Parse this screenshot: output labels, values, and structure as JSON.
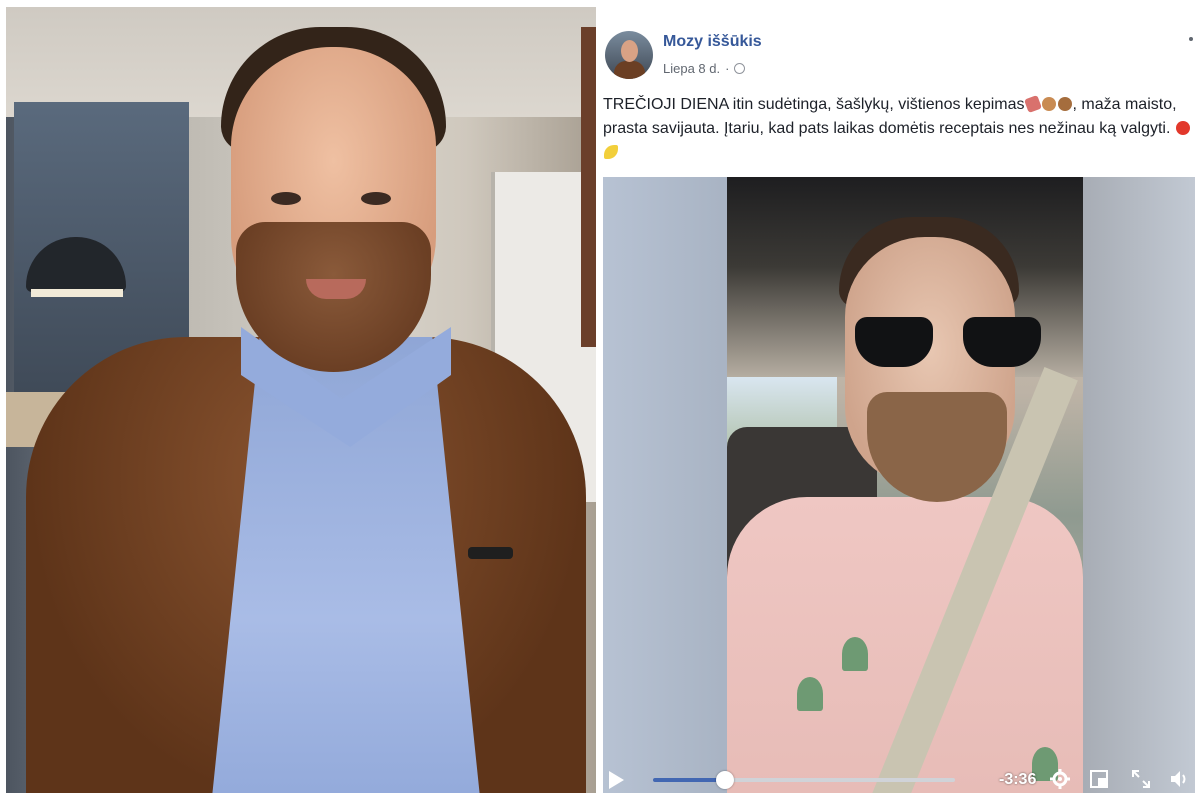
{
  "post": {
    "author": "Mozy iššūkis",
    "date": "Liepa 8 d.",
    "separator": "·",
    "text_part1": "TREČIOJI DIENA itin sudėtinga, šašlykų, vištienos kepimas",
    "text_part2": ", maža maisto, prasta savijauta. Įtariu, kad pats laikas domėtis receptais nes nežinau ką valgyti. ",
    "emojis_1": [
      "meat-emoji",
      "poultry-leg-emoji",
      "poultry-leg-emoji"
    ],
    "emojis_2": [
      "tomato-emoji",
      "banana-emoji"
    ]
  },
  "video": {
    "time_remaining": "-3:36",
    "progress": 0.24,
    "accent_color": "#4267b2",
    "icons": [
      "play-icon",
      "settings-icon",
      "pip-icon",
      "fullscreen-icon",
      "volume-icon"
    ]
  }
}
